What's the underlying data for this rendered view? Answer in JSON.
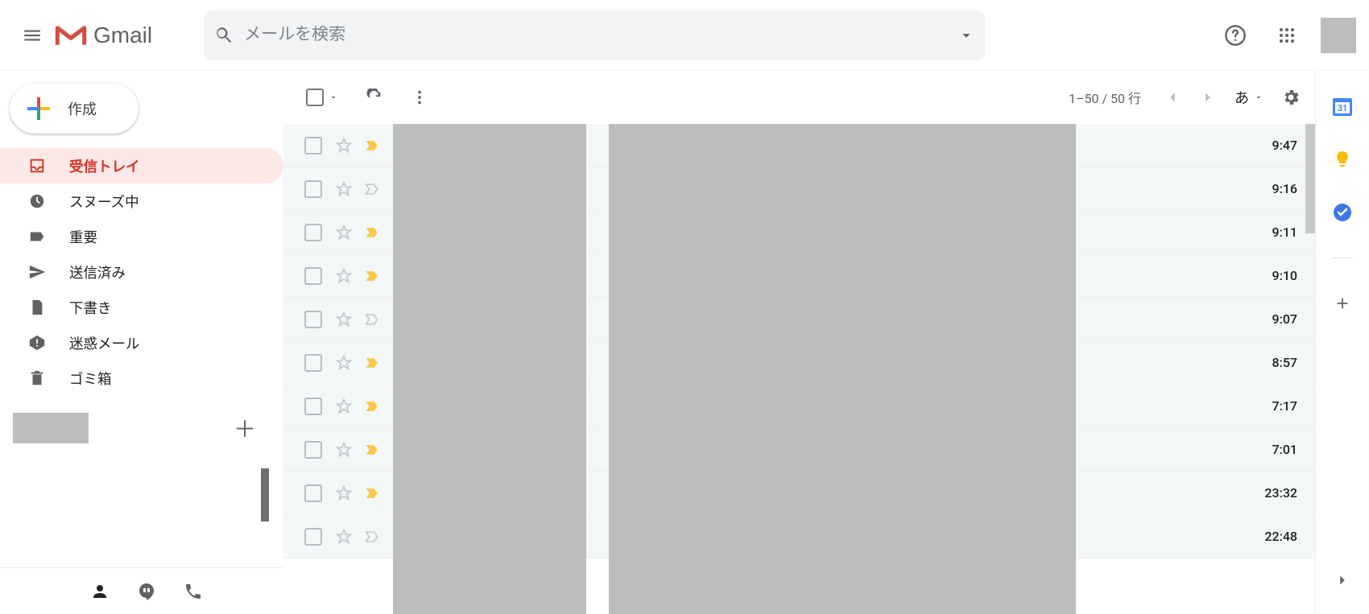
{
  "header": {
    "logo_text": "Gmail",
    "search_placeholder": "メールを検索"
  },
  "compose_label": "作成",
  "sidebar": {
    "items": [
      {
        "id": "inbox",
        "label": "受信トレイ",
        "icon": "inbox",
        "active": true
      },
      {
        "id": "snoozed",
        "label": "スヌーズ中",
        "icon": "clock",
        "active": false
      },
      {
        "id": "important",
        "label": "重要",
        "icon": "tag",
        "active": false
      },
      {
        "id": "sent",
        "label": "送信済み",
        "icon": "send",
        "active": false
      },
      {
        "id": "drafts",
        "label": "下書き",
        "icon": "file",
        "active": false
      },
      {
        "id": "spam",
        "label": "迷惑メール",
        "icon": "alert",
        "active": false
      },
      {
        "id": "trash",
        "label": "ゴミ箱",
        "icon": "trash",
        "active": false
      }
    ]
  },
  "toolbar": {
    "pagination": "1–50 / 50 行",
    "input_method": "あ"
  },
  "emails": [
    {
      "time": "9:47",
      "important": true
    },
    {
      "time": "9:16",
      "important": false
    },
    {
      "time": "9:11",
      "important": true
    },
    {
      "time": "9:10",
      "important": true
    },
    {
      "time": "9:07",
      "important": false
    },
    {
      "time": "8:57",
      "important": true
    },
    {
      "time": "7:17",
      "important": true
    },
    {
      "time": "7:01",
      "important": true
    },
    {
      "time": "23:32",
      "important": true
    },
    {
      "time": "22:48",
      "important": false
    }
  ],
  "sidepanel": {
    "calendar_day": "31"
  }
}
